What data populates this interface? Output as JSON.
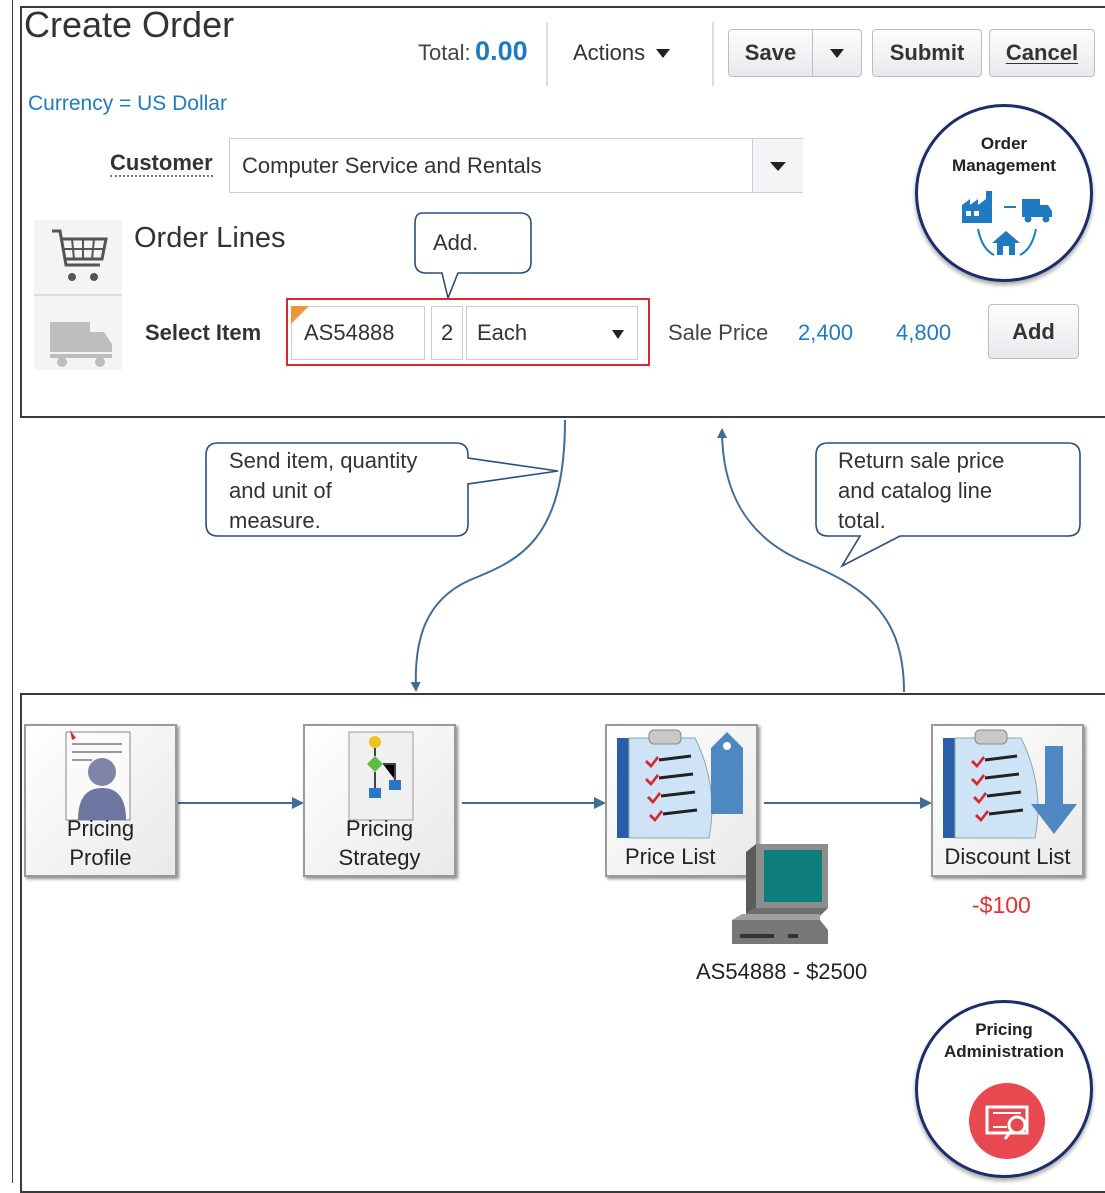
{
  "header": {
    "title": "Create Order",
    "total_label": "Total:",
    "total_value": "0.00",
    "actions_label": "Actions",
    "save_label": "Save",
    "submit_label": "Submit",
    "cancel_label": "Cancel",
    "currency": "Currency = US Dollar"
  },
  "customer": {
    "label": "Customer",
    "value": "Computer Service and Rentals"
  },
  "order_lines": {
    "title": "Order Lines",
    "select_item_label": "Select Item",
    "item": "AS54888",
    "quantity": "2",
    "uom": "Each",
    "sale_price_label": "Sale Price",
    "sale_price": "2,400",
    "line_total": "4,800",
    "add_button": "Add"
  },
  "callouts": {
    "add": "Add.",
    "send_line1": "Send item, quantity",
    "send_line2": "and unit of",
    "send_line3": "measure.",
    "return_line1": "Return sale price",
    "return_line2": "and catalog line",
    "return_line3": "total."
  },
  "badges": {
    "order_management_line1": "Order",
    "order_management_line2": "Management",
    "pricing_admin_line1": "Pricing",
    "pricing_admin_line2": "Administration"
  },
  "pricing_flow": {
    "profile_line1": "Pricing",
    "profile_line2": "Profile",
    "strategy_line1": "Pricing",
    "strategy_line2": "Strategy",
    "price_list": "Price List",
    "discount_list": "Discount List",
    "discount_value": "-$100",
    "price_item": "AS54888 - $2500"
  },
  "colors": {
    "accent": "#1f7bc1",
    "badge_border": "#1b2d6b",
    "discount": "#e8302f",
    "highlight_box": "#d9272e"
  }
}
